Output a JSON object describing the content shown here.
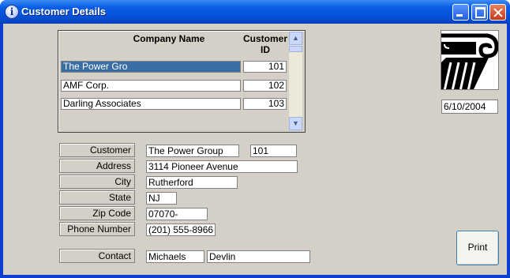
{
  "window": {
    "title": "Customer Details"
  },
  "grid": {
    "headers": {
      "company": "Company Name",
      "customer_id_line1": "Customer",
      "customer_id_line2": "ID"
    },
    "rows": [
      {
        "company": "The Power Gro",
        "id": "101"
      },
      {
        "company": "AMF Corp.",
        "id": "102"
      },
      {
        "company": "Darling Associates",
        "id": "103"
      }
    ]
  },
  "date": "6/10/2004",
  "form": {
    "customer_label": "Customer",
    "customer_name": "The Power Group",
    "customer_id": "101",
    "address_label": "Address",
    "address": "3114 Pioneer Avenue",
    "city_label": "City",
    "city": "Rutherford",
    "state_label": "State",
    "state": "NJ",
    "zip_label": "Zip Code",
    "zip": "07070-",
    "phone_label": "Phone Number",
    "phone": "(201) 555-8966",
    "contact_label": "Contact",
    "contact_first": "Michaels",
    "contact_last": "Devlin"
  },
  "buttons": {
    "print": "Print"
  },
  "icons": {
    "window_icon": "info-icon",
    "logo": "column-capital-logo"
  }
}
